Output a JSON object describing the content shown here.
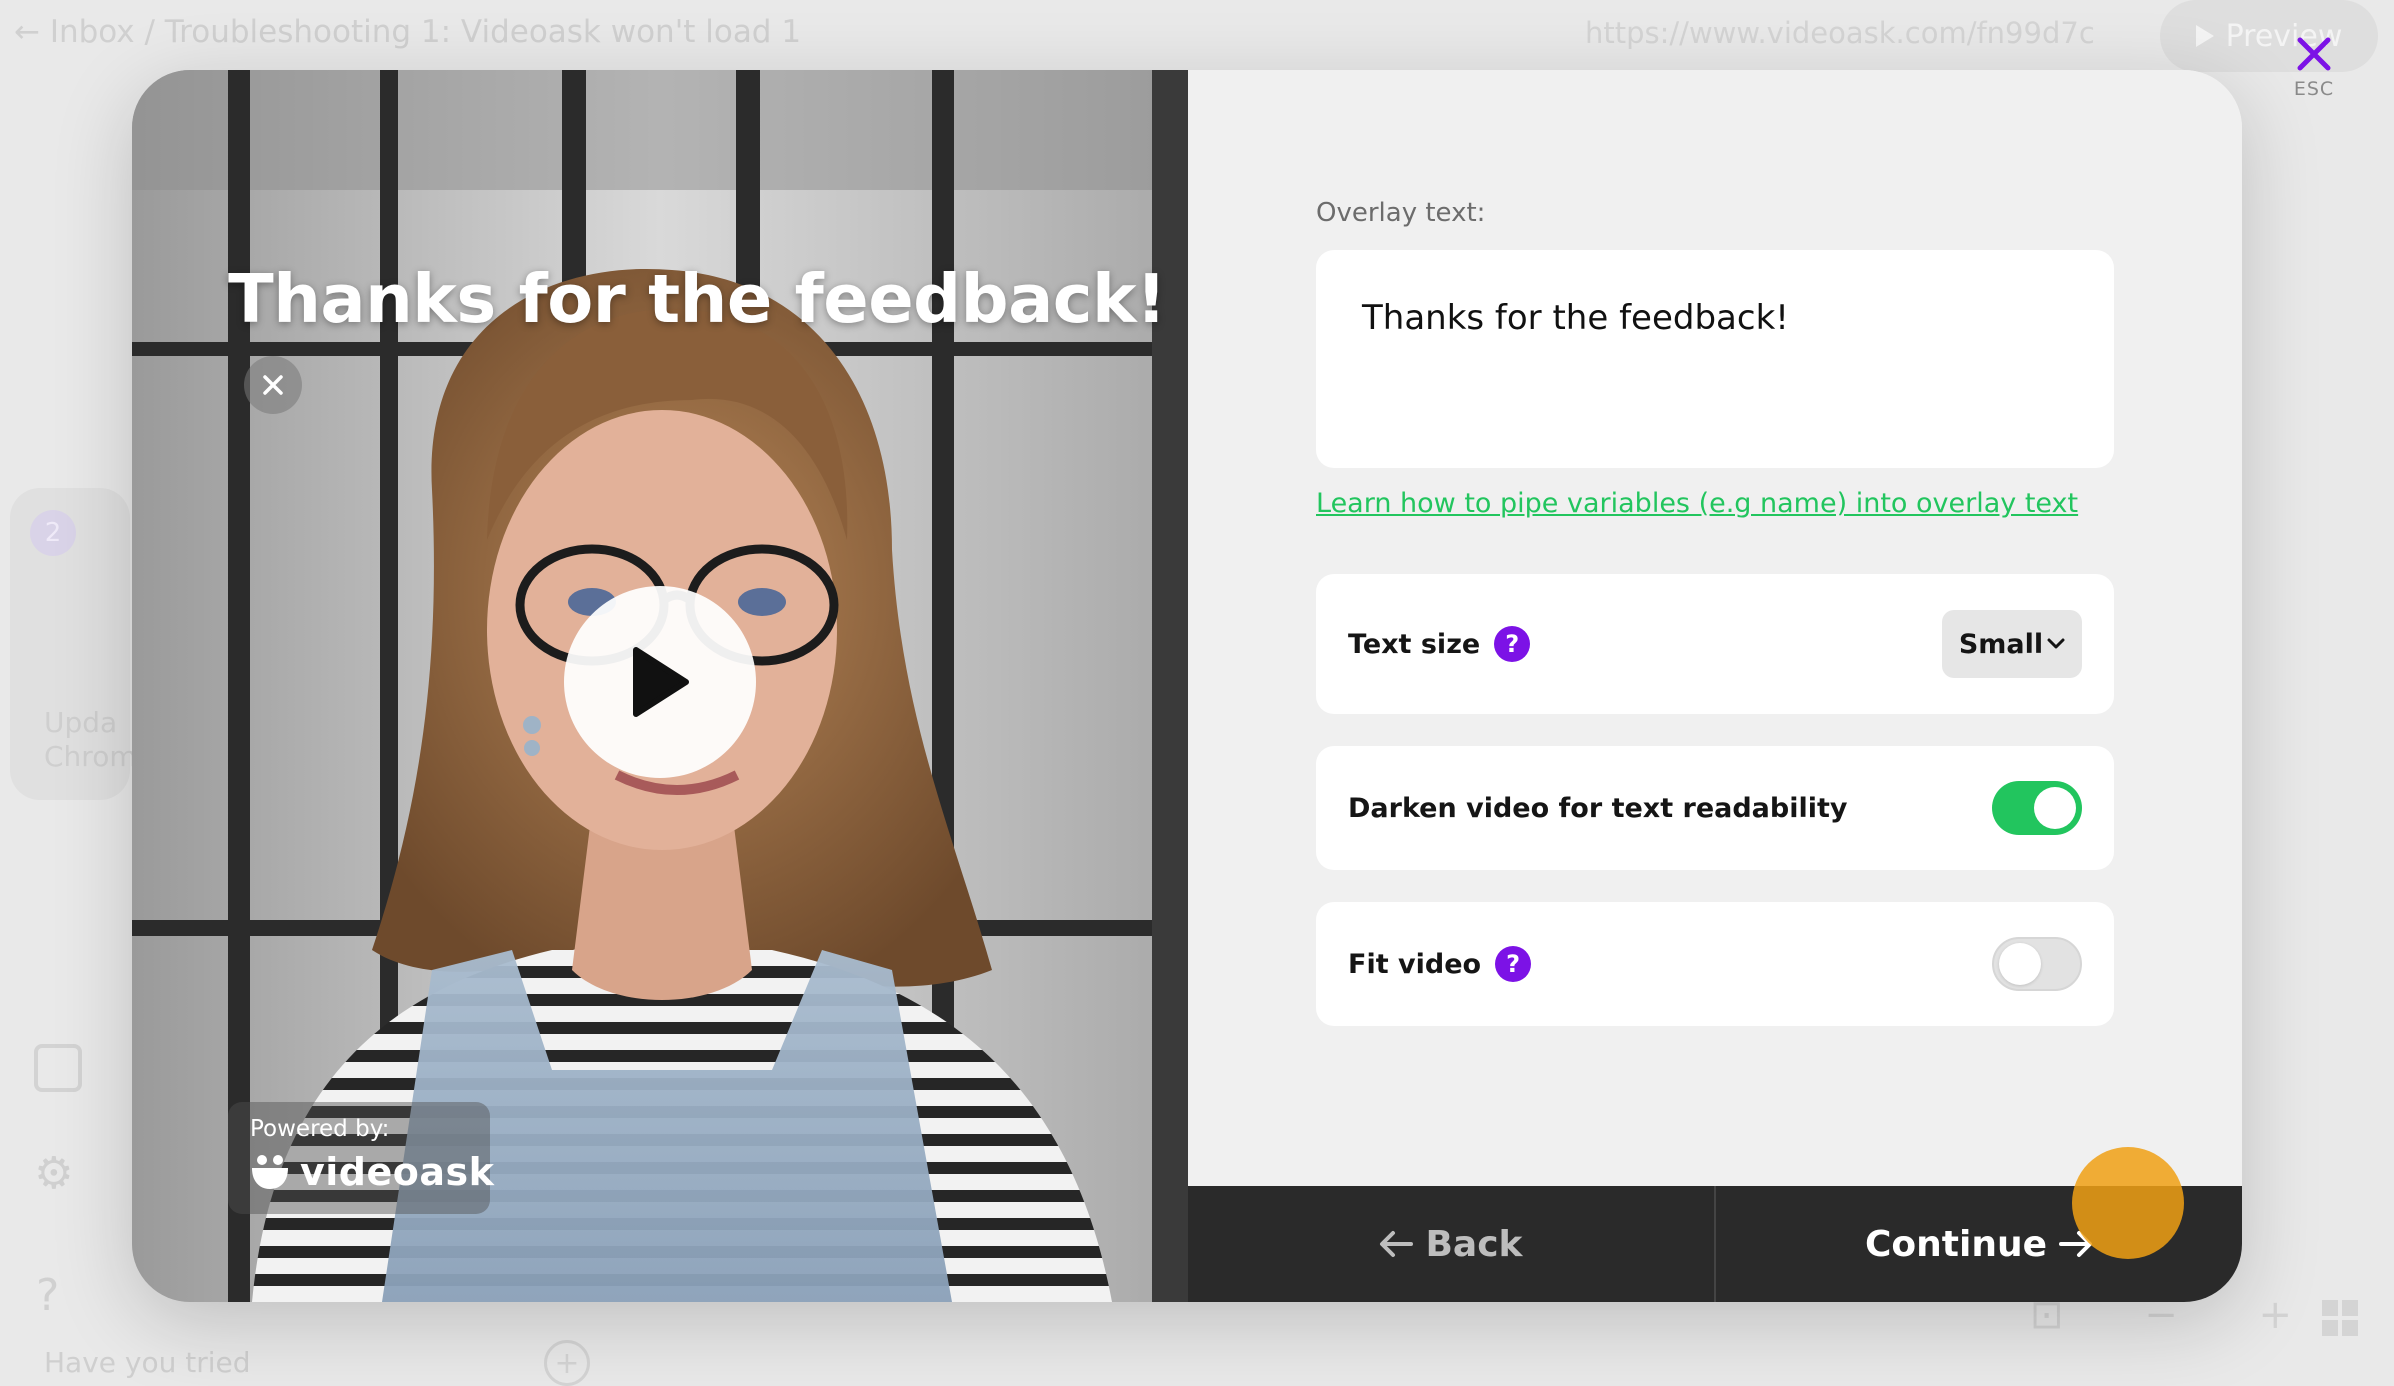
{
  "background": {
    "breadcrumb": "← Inbox / Troubleshooting 1: Videoask won't load 1",
    "url": "https://www.videoask.com/fn99d7c",
    "preview_label": "Preview",
    "step_badge": "2",
    "card_text_line1": "Upda",
    "card_text_line2": "Chrom",
    "bottom_text": "Have you tried"
  },
  "esc": {
    "label": "ESC"
  },
  "video": {
    "overlay_title": "Thanks for the feedback!",
    "powered_by": "Powered by:",
    "brand_name": "videoask"
  },
  "panel": {
    "overlay_label": "Overlay text:",
    "overlay_value": "Thanks for the feedback!",
    "pipe_link": "Learn how to pipe variables (e.g name) into overlay text",
    "text_size_label": "Text size",
    "text_size_value": "Small",
    "darken_label": "Darken video for text readability",
    "darken_on": true,
    "fit_label": "Fit video",
    "fit_on": false
  },
  "footer": {
    "back_label": "Back",
    "continue_label": "Continue"
  },
  "colors": {
    "accent_purple": "#7c12e6",
    "toggle_green": "#22c55e",
    "footer_bg": "#2a2a2a"
  }
}
